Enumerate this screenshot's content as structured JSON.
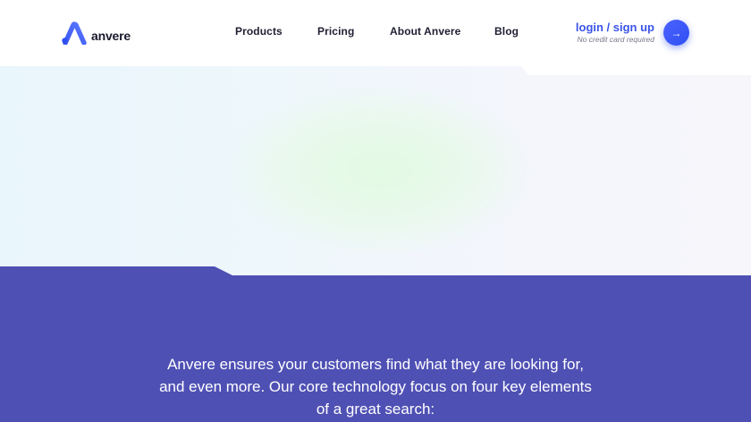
{
  "brand": {
    "name": "anvere"
  },
  "nav": {
    "items": [
      {
        "label": "Products"
      },
      {
        "label": "Pricing"
      },
      {
        "label": "About Anvere"
      },
      {
        "label": "Blog"
      }
    ]
  },
  "cta": {
    "link_label": "login / sign up",
    "subtext": "No credit card required",
    "button_icon": "arrow-right-icon",
    "button_glyph": "→"
  },
  "intro": {
    "lines": [
      "Anvere ensures your customers find what they are looking for,",
      "and even more. Our core technology focus on four key elements",
      "of a great search:"
    ]
  },
  "colors": {
    "accent": "#3a54e8",
    "band": "#4f50b4",
    "text_dark": "#1f1f33"
  }
}
